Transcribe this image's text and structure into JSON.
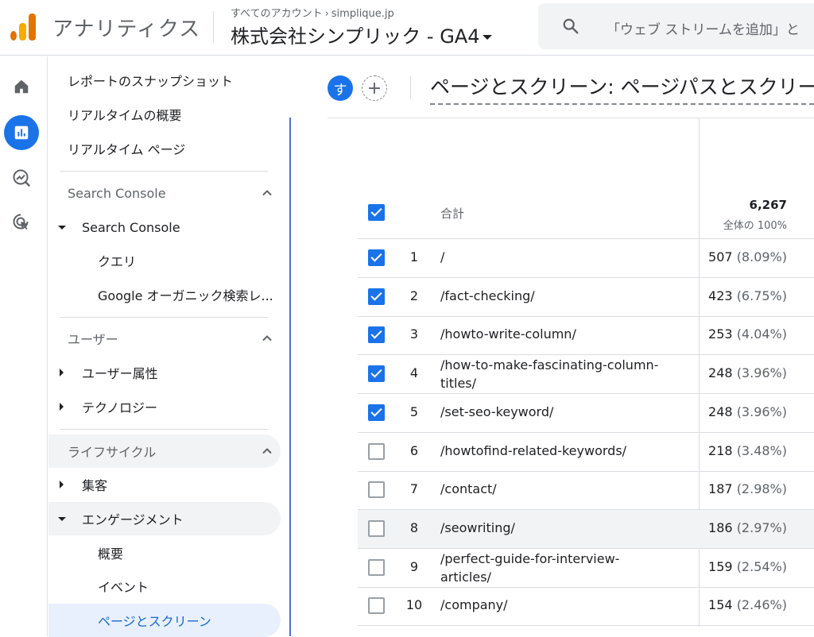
{
  "header": {
    "app_title": "アナリティクス",
    "account_breadcrumb": "すべてのアカウント",
    "account_domain": "simplique.jp",
    "property_name": "株式会社シンプリック - GA4",
    "search_placeholder": "「ウェブ ストリームを追加」と"
  },
  "rail": {
    "items": [
      "home-icon",
      "reports-icon",
      "explore-icon",
      "advertising-icon"
    ]
  },
  "nav": {
    "top_items": [
      "レポートのスナップショット",
      "リアルタイムの概要",
      "リアルタイム ページ"
    ],
    "search_console_section": "Search Console",
    "search_console_group": "Search Console",
    "search_console_items": [
      "クエリ",
      "Google オーガニック検索レ..."
    ],
    "user_section": "ユーザー",
    "user_items": [
      "ユーザー属性",
      "テクノロジー"
    ],
    "lifecycle_section": "ライフサイクル",
    "acquisition": "集客",
    "engagement": "エンゲージメント",
    "engagement_items": [
      "概要",
      "イベント",
      "ページとスクリーン"
    ]
  },
  "report": {
    "avatar_letter": "す",
    "add_comparison": "+",
    "title": "ページとスクリーン: ページパスとスクリーン"
  },
  "table": {
    "total_label": "合計",
    "total_value": "6,267",
    "total_sub": "全体の 100%",
    "rows": [
      {
        "n": "1",
        "path": "/",
        "value": "507",
        "pct": "(8.09%)",
        "checked": true
      },
      {
        "n": "2",
        "path": "/fact-checking/",
        "value": "423",
        "pct": "(6.75%)",
        "checked": true
      },
      {
        "n": "3",
        "path": "/howto-write-column/",
        "value": "253",
        "pct": "(4.04%)",
        "checked": true
      },
      {
        "n": "4",
        "path": "/how-to-make-fascinating-column-titles/",
        "value": "248",
        "pct": "(3.96%)",
        "checked": true
      },
      {
        "n": "5",
        "path": "/set-seo-keyword/",
        "value": "248",
        "pct": "(3.96%)",
        "checked": true
      },
      {
        "n": "6",
        "path": "/howtofind-related-keywords/",
        "value": "218",
        "pct": "(3.48%)",
        "checked": false
      },
      {
        "n": "7",
        "path": "/contact/",
        "value": "187",
        "pct": "(2.98%)",
        "checked": false
      },
      {
        "n": "8",
        "path": "/seowriting/",
        "value": "186",
        "pct": "(2.97%)",
        "checked": false
      },
      {
        "n": "9",
        "path": "/perfect-guide-for-interview-articles/",
        "value": "159",
        "pct": "(2.54%)",
        "checked": false
      },
      {
        "n": "10",
        "path": "/company/",
        "value": "154",
        "pct": "(2.46%)",
        "checked": false
      }
    ]
  },
  "colors": {
    "accent": "#1a73e8",
    "logo_orange": "#f9ab00",
    "logo_dark": "#e37400"
  }
}
